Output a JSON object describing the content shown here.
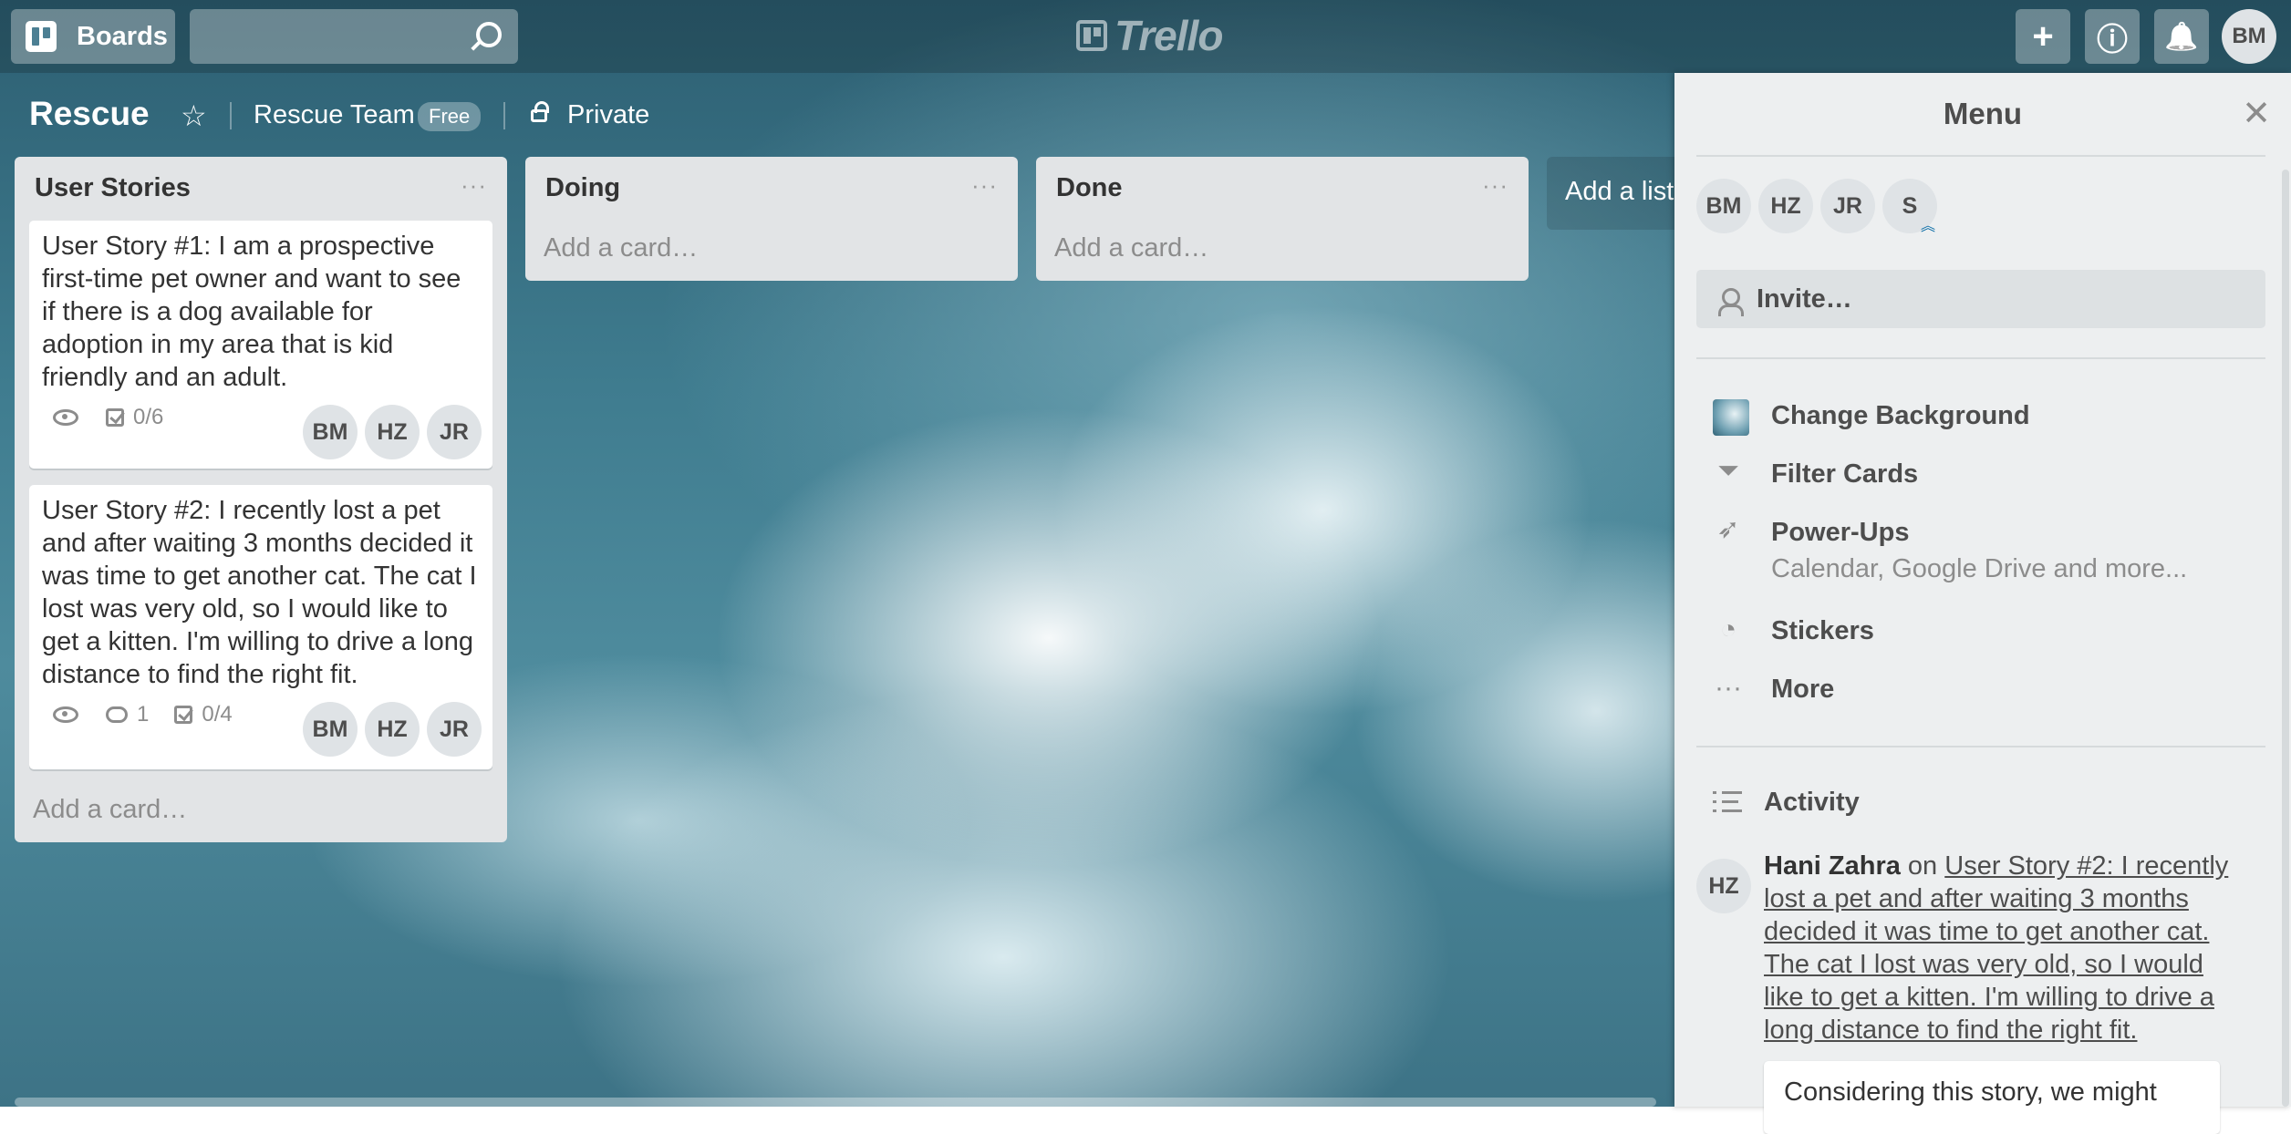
{
  "header": {
    "boards_label": "Boards",
    "logo_text": "Trello",
    "add_symbol": "+",
    "info_symbol": "ⓘ",
    "notif_symbol": "🔔",
    "user_initials": "BM"
  },
  "board": {
    "title": "Rescue",
    "team": "Rescue Team",
    "team_badge": "Free",
    "visibility": "Private"
  },
  "lists": [
    {
      "title": "User Stories",
      "menu": "···",
      "cards": [
        {
          "text": "User Story #1: I am a prospective first-time pet owner and want to see if there is a dog available for adoption in my area that is kid friendly and an adult.",
          "checklist": "0/6",
          "comments": "",
          "members": [
            "BM",
            "HZ",
            "JR"
          ]
        },
        {
          "text": "User Story #2: I recently lost a pet and after waiting 3 months decided it was time to get another cat. The cat I lost was very old, so I would like to get a kitten. I'm willing to drive a long distance to find the right fit.",
          "checklist": "0/4",
          "comments": "1",
          "members": [
            "BM",
            "HZ",
            "JR"
          ]
        }
      ],
      "add_card": "Add a card…"
    },
    {
      "title": "Doing",
      "menu": "···",
      "add_card": "Add a card…"
    },
    {
      "title": "Done",
      "menu": "···",
      "add_card": "Add a card…"
    }
  ],
  "add_list": "Add a list…",
  "menu": {
    "title": "Menu",
    "close": "✕",
    "members": [
      "BM",
      "HZ",
      "JR",
      "S"
    ],
    "admin_mark": "︽",
    "invite": "Invite…",
    "items": [
      {
        "label": "Change Background",
        "icon": "background-thumbnail"
      },
      {
        "label": "Filter Cards",
        "icon": "filter-icon"
      },
      {
        "label": "Power-Ups",
        "icon": "rocket-icon",
        "sub": "Calendar, Google Drive and more..."
      },
      {
        "label": "Stickers",
        "icon": "sticker-icon"
      },
      {
        "label": "More",
        "icon": "more-icon"
      }
    ],
    "activity_title": "Activity",
    "activity": {
      "avatar": "HZ",
      "who": "Hani Zahra",
      "on": " on ",
      "link": "User Story #2: I recently lost a pet and after waiting 3 months decided it was time to get another cat. The cat I lost was very old, so I would like to get a kitten. I'm willing to drive a long distance to find the right fit.",
      "comment": "Considering this story, we might"
    }
  }
}
